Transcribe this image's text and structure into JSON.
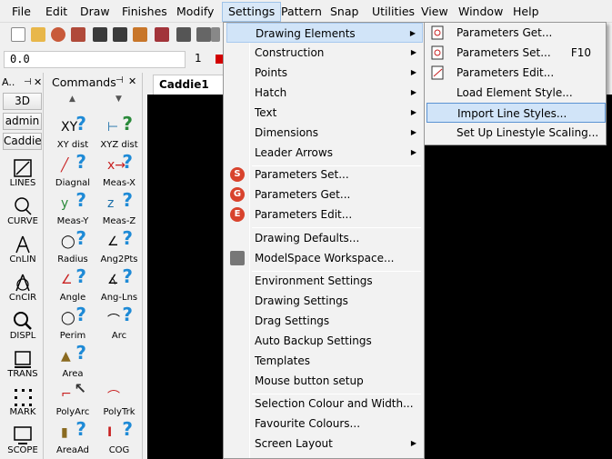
{
  "menubar": {
    "items": [
      {
        "label": "File"
      },
      {
        "label": "Edit"
      },
      {
        "label": "Draw"
      },
      {
        "label": "Finishes"
      },
      {
        "label": "Modify"
      },
      {
        "label": "Settings"
      },
      {
        "label": "Pattern"
      },
      {
        "label": "Snap"
      },
      {
        "label": "Utilities"
      },
      {
        "label": "View"
      },
      {
        "label": "Window"
      },
      {
        "label": "Help"
      }
    ]
  },
  "valuebar": {
    "input_value": "0.0",
    "layer_value": "1"
  },
  "panel_a": {
    "title": "A..",
    "buttons": [
      "3D",
      "admin",
      "Caddie"
    ],
    "tools": [
      "LINES",
      "CURVE",
      "CnLIN",
      "CnCIR",
      "DISPL",
      "TRANS",
      "MARK",
      "SCOPE"
    ]
  },
  "panel_commands": {
    "title": "Commands",
    "tools": [
      [
        "XY dist",
        "XYZ dist"
      ],
      [
        "Diagnal",
        "Meas-X"
      ],
      [
        "Meas-Y",
        "Meas-Z"
      ],
      [
        "Radius",
        "Ang2Pts"
      ],
      [
        "Angle",
        "Ang-Lns"
      ],
      [
        "Perim",
        "Arc"
      ],
      [
        "Area",
        ""
      ],
      [
        "PolyArc",
        "PolyTrk"
      ],
      [
        "AreaAd",
        "COG"
      ]
    ]
  },
  "drawing_tab": {
    "label": "Caddie1"
  },
  "settings_menu": {
    "items": [
      {
        "label": "Drawing Elements",
        "submenu": true
      },
      {
        "label": "Construction",
        "submenu": true
      },
      {
        "label": "Points",
        "submenu": true
      },
      {
        "label": "Hatch",
        "submenu": true
      },
      {
        "label": "Text",
        "submenu": true
      },
      {
        "label": "Dimensions",
        "submenu": true
      },
      {
        "label": "Leader Arrows",
        "submenu": true
      },
      {
        "label": "Parameters Set...",
        "badge": "S"
      },
      {
        "label": "Parameters Get...",
        "badge": "G"
      },
      {
        "label": "Parameters Edit...",
        "badge": "E"
      },
      {
        "label": "Drawing Defaults..."
      },
      {
        "label": "ModelSpace Workspace..."
      },
      {
        "label": "Environment Settings"
      },
      {
        "label": "Drawing Settings"
      },
      {
        "label": "Drag Settings"
      },
      {
        "label": "Auto Backup Settings"
      },
      {
        "label": "Templates"
      },
      {
        "label": "Mouse button setup"
      },
      {
        "label": "Selection Colour and Width..."
      },
      {
        "label": "Favourite Colours..."
      },
      {
        "label": "Screen Layout",
        "submenu": true
      }
    ]
  },
  "drawing_elements_submenu": {
    "items": [
      {
        "label": "Parameters Get...",
        "shortcut": ""
      },
      {
        "label": "Parameters Set...",
        "shortcut": "F10"
      },
      {
        "label": "Parameters Edit...",
        "shortcut": ""
      },
      {
        "label": "Load Element Style...",
        "shortcut": ""
      },
      {
        "label": "Import Line Styles...",
        "shortcut": ""
      },
      {
        "label": "Set Up Linestyle Scaling...",
        "shortcut": ""
      }
    ]
  },
  "arrow_glyph": "▶"
}
